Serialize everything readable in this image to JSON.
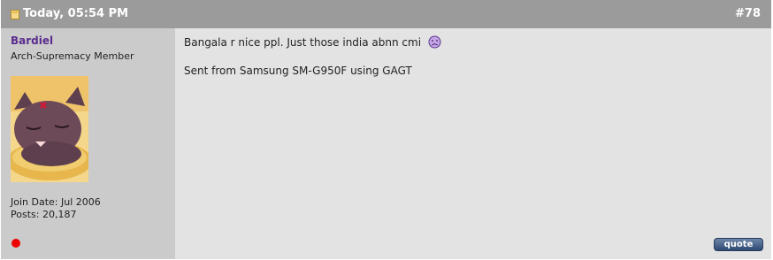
{
  "post": {
    "date": "Today, 05:54 PM",
    "number": "#78",
    "user": {
      "name": "Bardiel",
      "title": "Arch-Supremacy Member",
      "join_date": "Join Date: Jul 2006",
      "posts": "Posts: 20,187",
      "status_color": "#ee0000"
    },
    "message": {
      "line1": "Bangala r nice ppl. Just those india abnn cmi",
      "line1_emoji": "sad-face-icon",
      "line2": "Sent from Samsung SM-G950F using GAGT"
    },
    "quote_label": "quote"
  },
  "colors": {
    "header_bg": "#9b9b9b",
    "user_panel_bg": "#cbcbcb",
    "message_bg": "#e3e3e3",
    "username": "#5b2c8e"
  }
}
